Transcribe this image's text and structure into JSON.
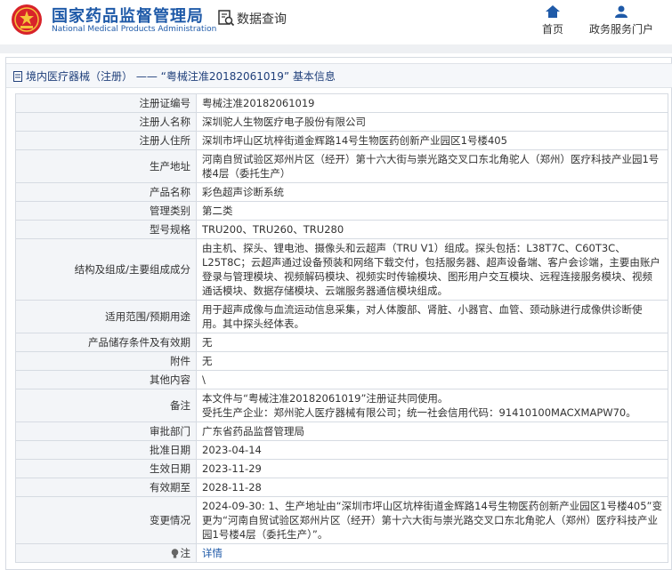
{
  "header": {
    "site_title_cn": "国家药品监督管理局",
    "site_title_en": "National Medical Products Administration",
    "data_query": "数据查询",
    "nav": {
      "home": "首页",
      "services": "政务服务门户"
    }
  },
  "breadcrumb": "境内医疗器械（注册） ——  “粤械注准20182061019”  基本信息",
  "rows": [
    {
      "label": "注册证编号",
      "value": "粤械注准20182061019"
    },
    {
      "label": "注册人名称",
      "value": "深圳驼人生物医疗电子股份有限公司"
    },
    {
      "label": "注册人住所",
      "value": "深圳市坪山区坑梓街道金辉路14号生物医药创新产业园区1号楼405"
    },
    {
      "label": "生产地址",
      "value": "河南自贸试验区郑州片区（经开）第十六大街与崇光路交叉口东北角驼人（郑州）医疗科技产业园1号楼4层（委托生产）"
    },
    {
      "label": "产品名称",
      "value": "彩色超声诊断系统"
    },
    {
      "label": "管理类别",
      "value": "第二类"
    },
    {
      "label": "型号规格",
      "value": "TRU200、TRU260、TRU280"
    },
    {
      "label": "结构及组成/主要组成成分",
      "value": "由主机、探头、锂电池、摄像头和云超声（TRU V1）组成。探头包括：L38T7C、C60T3C、L25T8C；云超声通过设备预装和网络下载交付，包括服务器、超声设备端、客户会诊端，主要由账户登录与管理模块、视频解码模块、视频实时传输模块、图形用户交互模块、远程连接服务模块、视频通话模块、数据存储模块、云端服务器通信模块组成。"
    },
    {
      "label": "适用范围/预期用途",
      "value": "用于超声成像与血流运动信息采集，对人体腹部、肾脏、小器官、血管、颈动脉进行成像供诊断使用。其中探头经体表。"
    },
    {
      "label": "产品储存条件及有效期",
      "value": "无"
    },
    {
      "label": "附件",
      "value": "无"
    },
    {
      "label": "其他内容",
      "value": "\\"
    },
    {
      "label": "备注",
      "value": "本文件与“粤械注准20182061019”注册证共同使用。\n受托生产企业：郑州驼人医疗器械有限公司；统一社会信用代码：91410100MACXMAPW70。"
    },
    {
      "label": "审批部门",
      "value": "广东省药品监督管理局"
    },
    {
      "label": "批准日期",
      "value": "2023-04-14"
    },
    {
      "label": "生效日期",
      "value": "2023-11-29"
    },
    {
      "label": "有效期至",
      "value": "2028-11-28"
    },
    {
      "label": "变更情况",
      "value": "2024-09-30: 1、生产地址由“深圳市坪山区坑梓街道金辉路14号生物医药创新产业园区1号楼405”变更为“河南自贸试验区郑州片区（经开）第十六大街与崇光路交叉口东北角驼人（郑州）医疗科技产业园1号楼4层（委托生产）”。"
    }
  ],
  "note": {
    "label": "注",
    "link": "详情"
  },
  "colors": {
    "brand": "#1f5aa8",
    "label_bg": "#f3f5f8",
    "border": "#d6dbe2"
  }
}
